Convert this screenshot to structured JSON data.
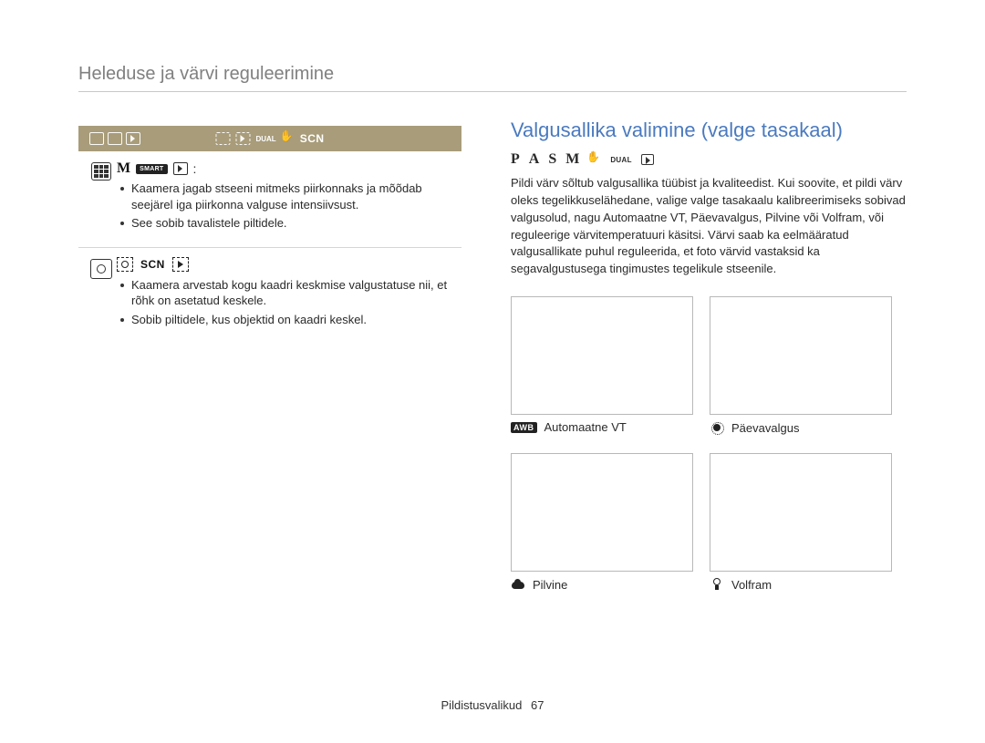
{
  "header": {
    "title": "Heleduse ja värvi reguleerimine"
  },
  "left": {
    "modebar": {
      "video_icon": "video-icon",
      "camera_icon": "camera-icon",
      "play_icon": "play-icon",
      "dashpreview_icon": "preview-icon",
      "dashplay_icon": "play-outline-icon",
      "dual_label": "DUAL",
      "hand_icon": "hand-icon",
      "scn_label": "SCN"
    },
    "rows": [
      {
        "icon_name": "matrix-metering-icon",
        "mode_letter": "M",
        "smart_label": "SMART",
        "bullets": [
          "Kaamera jagab stseeni mitmeks piirkonnaks ja mõõdab seejärel iga piirkonna valguse intensiivsust.",
          "See sobib tavalistele piltidele."
        ]
      },
      {
        "icon_name": "centre-metering-icon",
        "mode_letter": "",
        "scn_label": "SCN",
        "bullets": [
          "Kaamera arvestab kogu kaadri keskmise valgustatuse nii, et rõhk on asetatud keskele.",
          "Sobib piltidele, kus objektid on kaadri keskel."
        ]
      }
    ]
  },
  "right": {
    "title": "Valgusallika valimine (valge tasakaal)",
    "modes": {
      "p": "P",
      "a": "A",
      "s": "S",
      "m": "M",
      "dual": "DUAL"
    },
    "paragraph": "Pildi värv sõltub valgusallika tüübist ja kvaliteedist. Kui soovite, et pildi värv oleks tegelikkuselähedane, valige valge tasakaalu kalibreerimiseks sobivad valgusolud, nagu Automaatne VT, Päevavalgus, Pilvine või Volfram, või reguleerige värvitemperatuuri käsitsi. Värvi saab ka eelmääratud valgusallikate puhul reguleerida, et foto värvid vastaksid ka segavalgustusega tingimustes tegelikule stseenile.",
    "wb": [
      {
        "icon": "awb",
        "label": "Automaatne VT",
        "badge": "AWB"
      },
      {
        "icon": "sun",
        "label": "Päevavalgus"
      },
      {
        "icon": "cloud",
        "label": "Pilvine"
      },
      {
        "icon": "bulb",
        "label": "Volfram"
      }
    ]
  },
  "footer": {
    "section": "Pildistusvalikud",
    "page": "67"
  }
}
